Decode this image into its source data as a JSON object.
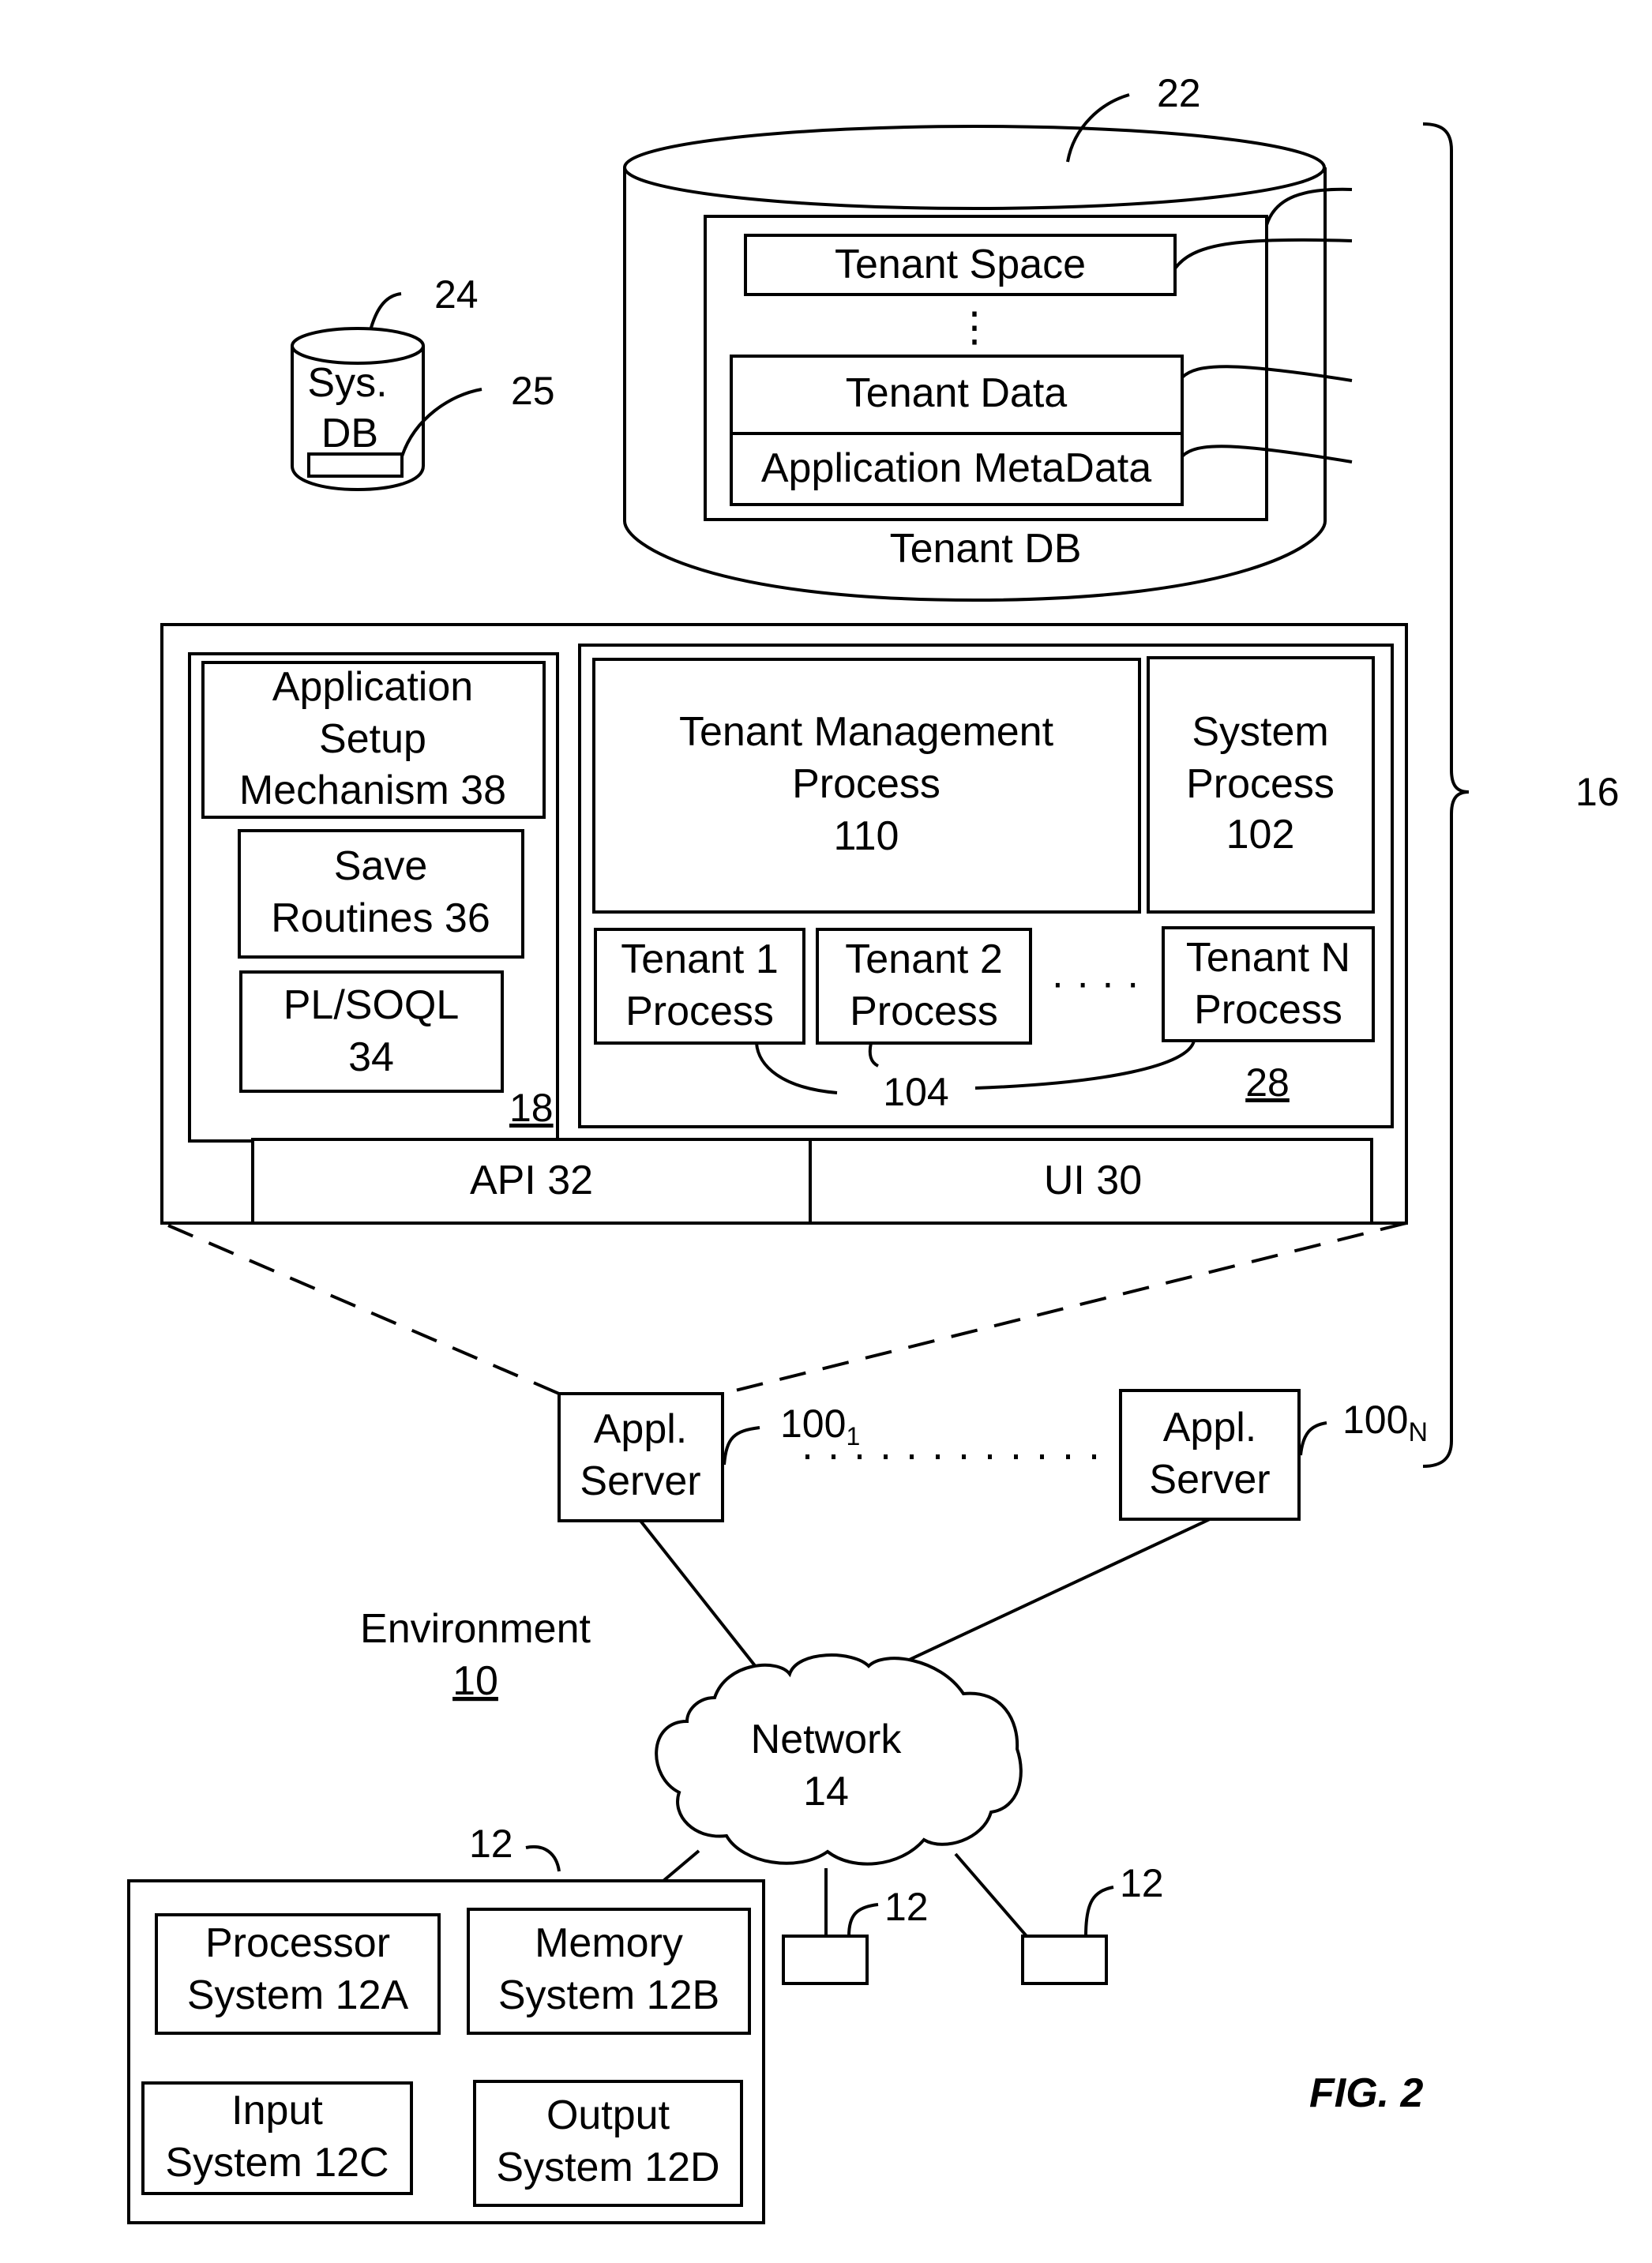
{
  "figure": {
    "label": "FIG. 2"
  },
  "environment": {
    "label": "Environment",
    "ref": "10"
  },
  "tenant_db": {
    "ref": "22",
    "label": "Tenant DB",
    "tenant_space": "Tenant Space",
    "ellipsis": "⋮",
    "tenant_data": "Tenant Data",
    "app_metadata": "Application MetaData"
  },
  "sys_db": {
    "ref": "24",
    "line1": "Sys.",
    "line2": "DB",
    "item_ref": "25"
  },
  "system_ref": "16",
  "app_server_internals": {
    "left_ref": "18",
    "app_setup": [
      "Application",
      "Setup",
      "Mechanism 38"
    ],
    "save_routines": [
      "Save",
      "Routines 36"
    ],
    "plsoql": [
      "PL/SOQL",
      "34"
    ],
    "right_ref": "28",
    "tenant_mgmt": [
      "Tenant Management",
      "Process",
      "110"
    ],
    "system_process": [
      "System",
      "Process",
      "102"
    ],
    "tenant_processes": [
      {
        "line1": "Tenant 1",
        "line2": "Process"
      },
      {
        "line1": "Tenant 2",
        "line2": "Process"
      },
      {
        "line1": "Tenant N",
        "line2": "Process"
      }
    ],
    "tenant_ellipsis": "· · · ·",
    "tenant_process_ref": "104",
    "api": "API 32",
    "ui": "UI 30"
  },
  "app_servers": [
    {
      "line1": "Appl.",
      "line2": "Server",
      "ref_base": "100",
      "ref_sub": "1"
    },
    {
      "line1": "Appl.",
      "line2": "Server",
      "ref_base": "100",
      "ref_sub": "N"
    }
  ],
  "network": {
    "line1": "Network",
    "line2": "14"
  },
  "user_system": {
    "ref": "12",
    "components": [
      {
        "line1": "Processor",
        "line2": "System 12A"
      },
      {
        "line1": "Memory",
        "line2": "System 12B"
      },
      {
        "line1": "Input",
        "line2": "System 12C"
      },
      {
        "line1": "Output",
        "line2": "System 12D"
      }
    ],
    "other_clients": [
      {
        "ref": "12"
      },
      {
        "ref": "12"
      }
    ]
  }
}
